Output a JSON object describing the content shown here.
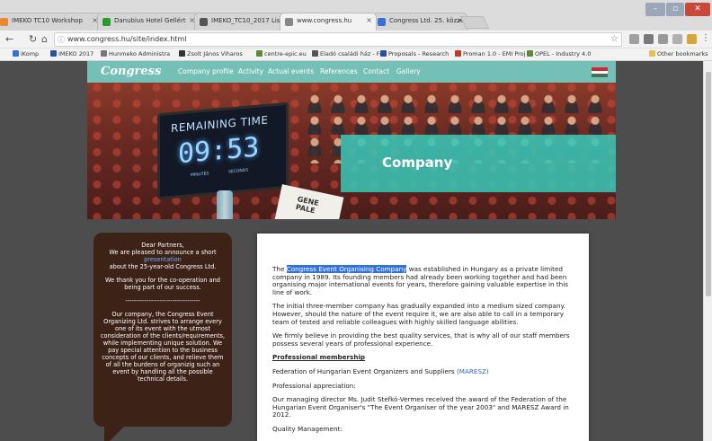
{
  "browser": {
    "tabs": [
      {
        "label": "IMEKO TC10 Workshop",
        "active": false,
        "color": "#e8892a"
      },
      {
        "label": "Danubius Hotel Gellért",
        "active": false,
        "color": "#2f9a2f"
      },
      {
        "label": "IMEKO_TC10_2017 List",
        "active": false,
        "color": "#555555"
      },
      {
        "label": "www.congress.hu",
        "active": true,
        "color": "#888888"
      },
      {
        "label": "Congress Ltd. 25. közzé",
        "active": false,
        "color": "#3b6fd6"
      }
    ],
    "close_glyph": "×",
    "url": "www.congress.hu/site/index.html",
    "bookmarks": [
      {
        "label": "iKomp",
        "color": "#3a6fd8"
      },
      {
        "label": "IMEKO 2017",
        "color": "#2a4fa0"
      },
      {
        "label": "Hunmeko Administra",
        "color": "#777777"
      },
      {
        "label": "Zsolt János Viharos",
        "color": "#333333"
      },
      {
        "label": "centre-epic.eu",
        "color": "#5a8a3a"
      },
      {
        "label": "Eladó családi ház - Fó",
        "color": "#555555"
      },
      {
        "label": "Proposals - Research",
        "color": "#2a4fa0"
      },
      {
        "label": "Proman 1.0 - EMI Proj",
        "color": "#c0392b"
      },
      {
        "label": "OPEL - Industry 4.0",
        "color": "#5a8a3a"
      }
    ],
    "other_bookmarks": "Other bookmarks"
  },
  "site": {
    "logo": "Congress",
    "nav": [
      "Company profile",
      "Activity",
      "Actual events",
      "References",
      "Contact",
      "Gallery"
    ],
    "flag_colors": [
      "#ce2939",
      "#ffffff",
      "#477050"
    ],
    "hero": {
      "timer_title": "REMAINING TIME",
      "timer_value": "09:53",
      "timer_minutes": "MINUTES",
      "timer_seconds": "SECONDS",
      "namecard": "GENE\nPALE",
      "section_title": "Company"
    },
    "bubble": {
      "greeting": "Dear Partners,",
      "announce": "We are pleased to announce a short",
      "link": "presentation",
      "about": "about the 25-year-old Congress Ltd.",
      "thanks": "We thank you for the co-operation and being part of our success.",
      "divider": "-----------------------------------",
      "mission": "Our company, the Congress Event Organizing Ltd. strives to arrange every one of its event with the utmost consideration of the clients/requirements, while implementing unique solution. We pay special attention to the business concepts of our clients, and relieve them of all the burdens of organizig such an event by handling all the possible technical details."
    },
    "content": {
      "p1_pre": "The",
      "p1_selected": "Congress Event Organising Company",
      "p1_post": "was established in Hungary as a private limited company in 1989. Its founding members had already been working together and had been organising major international events for years, therefore gaining valuable expertise in this line of work.",
      "p2": "The initial three-member company has gradually expanded into a medium sized company. However, should the nature of the event require it, we are also able to call in a temporary team of tested and reliable colleagues with highly skilled language abilities.",
      "p3": "We firmly believe in providing the best quality services, that is why all of our staff members possess several years of professional experience.",
      "membership_heading": "Professional membership",
      "federation": "Federation of Hungarian Event Organizers and Suppliers",
      "maresz": "(MARESZ)",
      "appreciation": "Professional appreciation:",
      "award": "Our managing director Ms. Judit Stefkó-Vermes received the award of the Federation of the Hungarian Event Organiser's \"The Event Organiser of the year 2003\" and MARESZ Award in 2012.",
      "quality": "Quality Management:"
    }
  }
}
